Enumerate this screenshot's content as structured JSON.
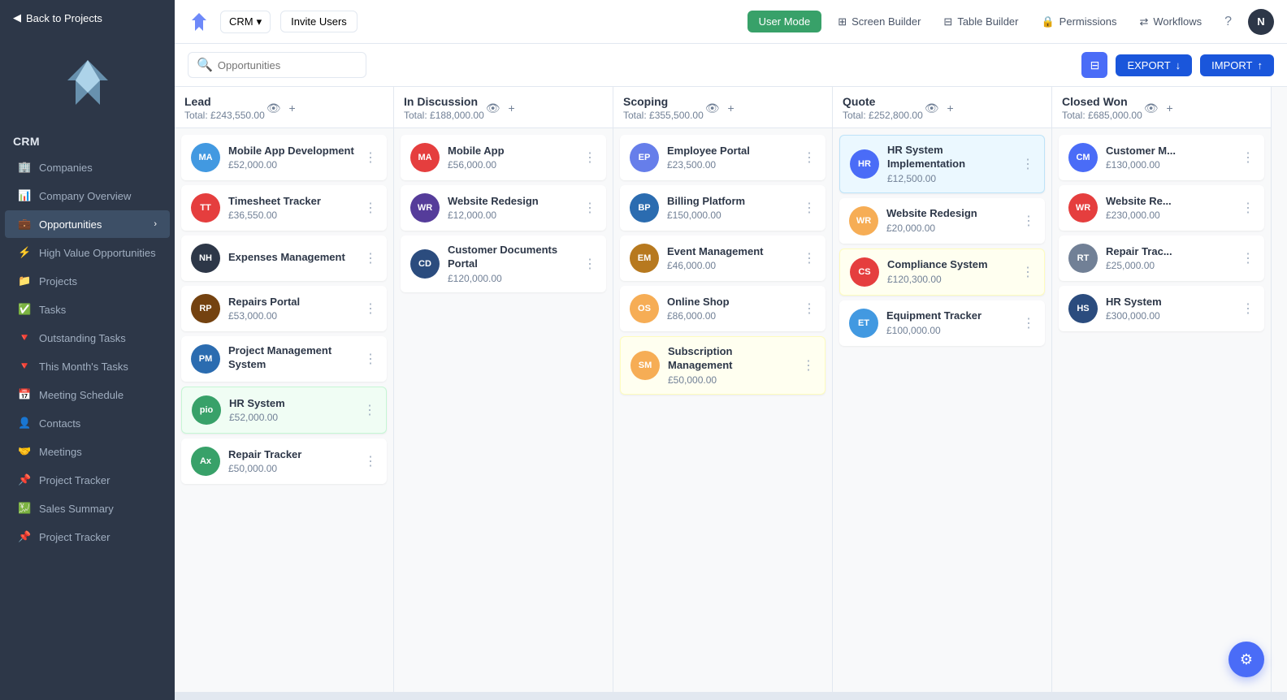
{
  "sidebar": {
    "back_label": "Back to Projects",
    "section_title": "CRM",
    "items": [
      {
        "id": "companies",
        "label": "Companies",
        "icon": "🏢",
        "active": false
      },
      {
        "id": "company-overview",
        "label": "Company Overview",
        "icon": "📊",
        "active": false
      },
      {
        "id": "opportunities",
        "label": "Opportunities",
        "icon": "💼",
        "active": true,
        "has_arrow": true
      },
      {
        "id": "high-value",
        "label": "High Value Opportunities",
        "icon": "⚡",
        "active": false
      },
      {
        "id": "projects",
        "label": "Projects",
        "icon": "📁",
        "active": false
      },
      {
        "id": "tasks",
        "label": "Tasks",
        "icon": "✅",
        "active": false
      },
      {
        "id": "outstanding-tasks",
        "label": "Outstanding Tasks",
        "icon": "🔻",
        "active": false
      },
      {
        "id": "this-months-tasks",
        "label": "This Month's Tasks",
        "icon": "🔻",
        "active": false
      },
      {
        "id": "meeting-schedule",
        "label": "Meeting Schedule",
        "icon": "📅",
        "active": false
      },
      {
        "id": "contacts",
        "label": "Contacts",
        "icon": "👤",
        "active": false
      },
      {
        "id": "meetings",
        "label": "Meetings",
        "icon": "🤝",
        "active": false
      },
      {
        "id": "project-tracker",
        "label": "Project Tracker",
        "icon": "📌",
        "active": false
      },
      {
        "id": "sales-summary",
        "label": "Sales Summary",
        "icon": "💹",
        "active": false
      },
      {
        "id": "project-tracker-2",
        "label": "Project Tracker",
        "icon": "📌",
        "active": false
      }
    ]
  },
  "topbar": {
    "crm_label": "CRM",
    "invite_label": "Invite Users",
    "user_mode_label": "User Mode",
    "screen_builder_label": "Screen Builder",
    "table_builder_label": "Table Builder",
    "permissions_label": "Permissions",
    "workflows_label": "Workflows",
    "avatar_label": "N"
  },
  "search": {
    "placeholder": "Opportunities",
    "export_label": "EXPORT",
    "import_label": "IMPORT"
  },
  "columns": [
    {
      "id": "lead",
      "title": "Lead",
      "total": "Total: £243,550.00",
      "cards": [
        {
          "id": 1,
          "name": "Mobile App Development",
          "amount": "£52,000.00",
          "avatar_bg": "#4299e1",
          "avatar_text": "MA",
          "highlight": false
        },
        {
          "id": 2,
          "name": "Timesheet Tracker",
          "amount": "£36,550.00",
          "avatar_bg": "#e53e3e",
          "avatar_text": "TT",
          "highlight": false
        },
        {
          "id": 3,
          "name": "Expenses Management",
          "amount": "",
          "avatar_bg": "#2d3748",
          "avatar_text": "NH",
          "highlight": false
        },
        {
          "id": 4,
          "name": "Repairs Portal",
          "amount": "£53,000.00",
          "avatar_bg": "#744210",
          "avatar_text": "RP",
          "highlight": false
        },
        {
          "id": 5,
          "name": "Project Management System",
          "amount": "",
          "avatar_bg": "#2b6cb0",
          "avatar_text": "PM",
          "highlight": false
        },
        {
          "id": 6,
          "name": "HR System",
          "amount": "£52,000.00",
          "avatar_bg": "#38a169",
          "avatar_text": "pio",
          "highlight": true
        },
        {
          "id": 7,
          "name": "Repair Tracker",
          "amount": "£50,000.00",
          "avatar_bg": "#38a169",
          "avatar_text": "Ax",
          "highlight": false
        }
      ]
    },
    {
      "id": "in-discussion",
      "title": "In Discussion",
      "total": "Total: £188,000.00",
      "cards": [
        {
          "id": 8,
          "name": "Mobile App",
          "amount": "£56,000.00",
          "avatar_bg": "#e53e3e",
          "avatar_text": "MA",
          "highlight": false
        },
        {
          "id": 9,
          "name": "Website Redesign",
          "amount": "£12,000.00",
          "avatar_bg": "#553c9a",
          "avatar_text": "WR",
          "highlight": false
        },
        {
          "id": 10,
          "name": "Customer Documents Portal",
          "amount": "£120,000.00",
          "avatar_bg": "#2b4c7e",
          "avatar_text": "CD",
          "highlight": false
        }
      ]
    },
    {
      "id": "scoping",
      "title": "Scoping",
      "total": "Total: £355,500.00",
      "cards": [
        {
          "id": 11,
          "name": "Employee Portal",
          "amount": "£23,500.00",
          "avatar_bg": "#667eea",
          "avatar_text": "EP",
          "highlight": false
        },
        {
          "id": 12,
          "name": "Billing Platform",
          "amount": "£150,000.00",
          "avatar_bg": "#2b6cb0",
          "avatar_text": "BP",
          "highlight": false
        },
        {
          "id": 13,
          "name": "Event Management",
          "amount": "£46,000.00",
          "avatar_bg": "#b7791f",
          "avatar_text": "EM",
          "highlight": false
        },
        {
          "id": 14,
          "name": "Online Shop",
          "amount": "£86,000.00",
          "avatar_bg": "#f6ad55",
          "avatar_text": "OS",
          "highlight": false
        },
        {
          "id": 15,
          "name": "Subscription Management",
          "amount": "£50,000.00",
          "avatar_bg": "#f6ad55",
          "avatar_text": "SM",
          "light_yellow": true
        }
      ]
    },
    {
      "id": "quote",
      "title": "Quote",
      "total": "Total: £252,800.00",
      "cards": [
        {
          "id": 16,
          "name": "HR System Implementation",
          "amount": "£12,500.00",
          "avatar_bg": "#4a6cf7",
          "avatar_text": "HR",
          "light_blue": true
        },
        {
          "id": 17,
          "name": "Website Redesign",
          "amount": "£20,000.00",
          "avatar_bg": "#f6ad55",
          "avatar_text": "WR",
          "highlight": false
        },
        {
          "id": 18,
          "name": "Compliance System",
          "amount": "£120,300.00",
          "avatar_bg": "#e53e3e",
          "avatar_text": "CS",
          "light_yellow": true
        },
        {
          "id": 19,
          "name": "Equipment Tracker",
          "amount": "£100,000.00",
          "avatar_bg": "#4299e1",
          "avatar_text": "ET",
          "highlight": false
        }
      ]
    },
    {
      "id": "closed-won",
      "title": "Closed Won",
      "total": "Total: £685,000.00",
      "cards": [
        {
          "id": 20,
          "name": "Customer M...",
          "amount": "£130,000.00",
          "avatar_bg": "#4a6cf7",
          "avatar_text": "CM",
          "highlight": false
        },
        {
          "id": 21,
          "name": "Website Re...",
          "amount": "£230,000.00",
          "avatar_bg": "#e53e3e",
          "avatar_text": "WR",
          "highlight": false
        },
        {
          "id": 22,
          "name": "Repair Trac...",
          "amount": "£25,000.00",
          "avatar_bg": "#718096",
          "avatar_text": "RT",
          "highlight": false
        },
        {
          "id": 23,
          "name": "HR System",
          "amount": "£300,000.00",
          "avatar_bg": "#2b4c7e",
          "avatar_text": "HS",
          "highlight": false
        }
      ]
    }
  ],
  "fab": {
    "icon": "⚙"
  }
}
